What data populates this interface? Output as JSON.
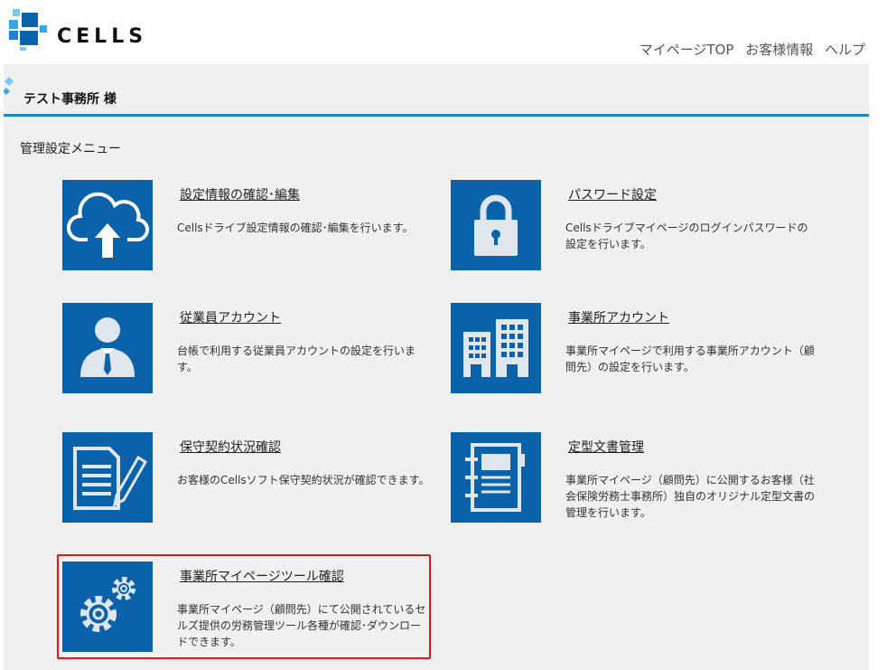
{
  "brand": {
    "name": "CELLS"
  },
  "topnav": {
    "items": [
      "マイページTOP",
      "お客様情報",
      "ヘルプ"
    ]
  },
  "guest": {
    "name": "テスト事務所 様"
  },
  "menu": {
    "heading": "管理設定メニュー",
    "cards": [
      {
        "icon": "cloud-upload-icon",
        "title": "設定情報の確認･編集",
        "desc": "Cellsドライブ設定情報の確認･編集を行います。"
      },
      {
        "icon": "lock-icon",
        "title": "パスワード設定",
        "desc": "Cellsドライブマイページのログインパスワードの設定を行います。"
      },
      {
        "icon": "employee-icon",
        "title": "従業員アカウント",
        "desc": "台帳で利用する従業員アカウントの設定を行います。"
      },
      {
        "icon": "office-building-icon",
        "title": "事業所アカウント",
        "desc": "事業所マイページで利用する事業所アカウント（顧問先）の設定を行います。"
      },
      {
        "icon": "contract-document-icon",
        "title": "保守契約状況確認",
        "desc": "お客様のCellsソフト保守契約状況が確認できます。"
      },
      {
        "icon": "notebook-icon",
        "title": "定型文書管理",
        "desc": "事業所マイページ（顧問先）に公開するお客様（社会保険労務士事務所）独自のオリジナル定型文書の管理を行います。"
      },
      {
        "icon": "gears-icon",
        "title": "事業所マイページツール確認",
        "desc": "事業所マイページ（顧問先）にて公開されているセルズ提供の労務管理ツール各種が確認･ダウンロードできます。"
      }
    ]
  },
  "colors": {
    "tile": "#0a62ab",
    "accent_rule": "#1a86d1",
    "highlight": "#e01818",
    "panel": "#f0f0f0"
  }
}
